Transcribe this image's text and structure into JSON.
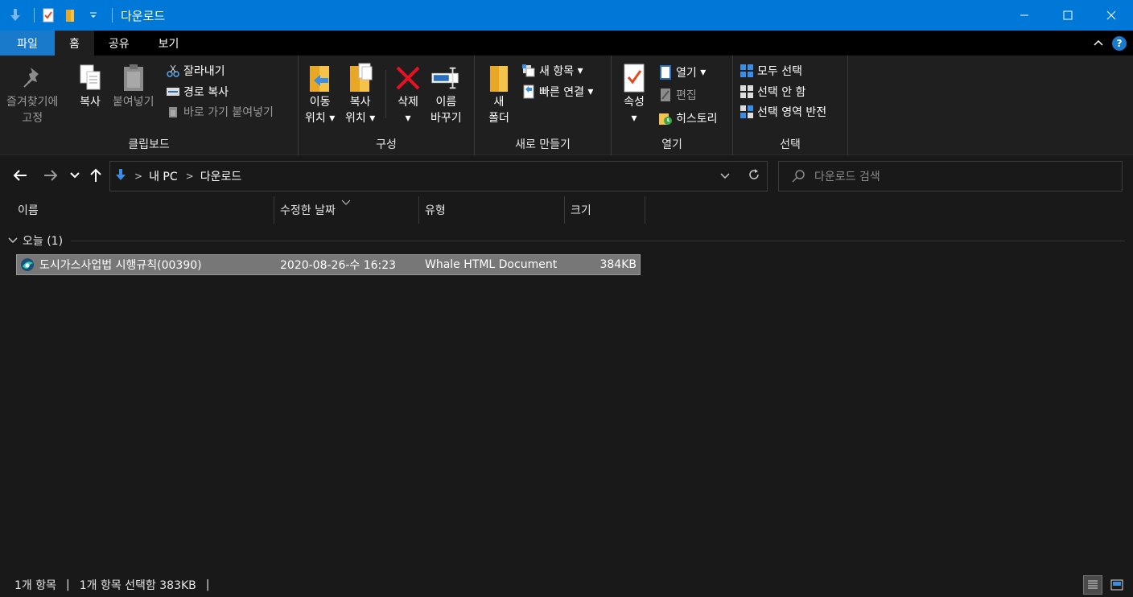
{
  "window": {
    "title": "다운로드"
  },
  "tabs": [
    {
      "label": "파일"
    },
    {
      "label": "홈"
    },
    {
      "label": "공유"
    },
    {
      "label": "보기"
    }
  ],
  "ribbon": {
    "clipboard": {
      "group_label": "클립보드",
      "pin_line1": "즐겨찾기에",
      "pin_line2": "고정",
      "copy": "복사",
      "paste": "붙여넣기",
      "cut": "잘라내기",
      "copy_path": "경로 복사",
      "paste_shortcut": "바로 가기 붙여넣기"
    },
    "organize": {
      "group_label": "구성",
      "move_line1": "이동",
      "move_line2": "위치",
      "copyto_line1": "복사",
      "copyto_line2": "위치",
      "delete": "삭제",
      "rename_line1": "이름",
      "rename_line2": "바꾸기"
    },
    "new": {
      "group_label": "새로 만들기",
      "new_folder_line1": "새",
      "new_folder_line2": "폴더",
      "new_item": "새 항목",
      "easy_access": "빠른 연결"
    },
    "open": {
      "group_label": "열기",
      "properties": "속성",
      "open": "열기",
      "edit": "편집",
      "history": "히스토리"
    },
    "select": {
      "group_label": "선택",
      "select_all": "모두 선택",
      "select_none": "선택 안 함",
      "invert": "선택 영역 반전"
    }
  },
  "address": {
    "crumbs": [
      "내 PC",
      "다운로드"
    ],
    "search_placeholder": "다운로드 검색"
  },
  "columns": [
    "이름",
    "수정한 날짜",
    "유형",
    "크기"
  ],
  "group": {
    "label": "오늘 (1)"
  },
  "files": [
    {
      "name": "도시가스사업법 시행규칙(00390)",
      "date": "2020-08-26-수 16:23",
      "type": "Whale HTML Document",
      "size": "384KB"
    }
  ],
  "status": {
    "count": "1개 항목",
    "selection": "1개 항목 선택함 383KB"
  },
  "colors": {
    "titlebar": "#0078d7",
    "file_tab": "#1979ca",
    "background": "#191919",
    "ribbon": "#1f1f1f",
    "selected_row": "#777777"
  }
}
